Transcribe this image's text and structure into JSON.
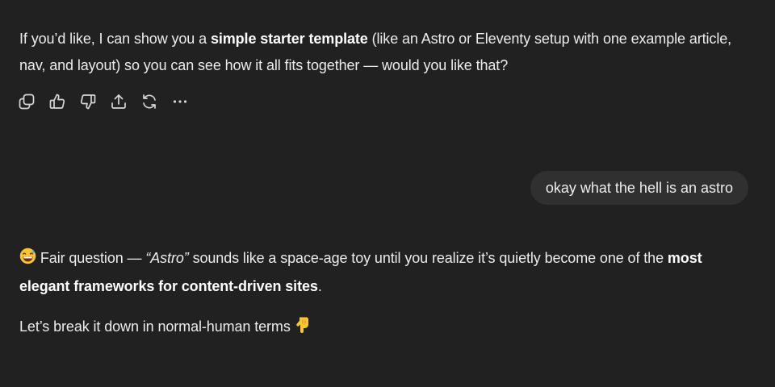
{
  "assistant_message_1": {
    "text_before": "If you’d like, I can show you a ",
    "bold": "simple starter template",
    "text_after": " (like an Astro or Eleventy setup with one example article, nav, and layout) so you can see how it all fits together — would you like that?"
  },
  "message_actions": [
    {
      "name": "copy-button",
      "icon": "copy-icon",
      "label": "Copy"
    },
    {
      "name": "good-response-button",
      "icon": "thumbs-up-icon",
      "label": "Good response"
    },
    {
      "name": "bad-response-button",
      "icon": "thumbs-down-icon",
      "label": "Bad response"
    },
    {
      "name": "share-button",
      "icon": "share-icon",
      "label": "Share"
    },
    {
      "name": "regenerate-button",
      "icon": "refresh-icon",
      "label": "Try again"
    },
    {
      "name": "more-actions-button",
      "icon": "more-horizontal-icon",
      "label": "More actions"
    }
  ],
  "user_message": {
    "text": "okay what the hell is an astro"
  },
  "assistant_message_2": {
    "emoji": "grinning-sweat-emoji",
    "text_1": " Fair question — ",
    "italic": "“Astro”",
    "text_2": " sounds like a space-age toy until you realize it’s quietly become one of the ",
    "bold": "most elegant frameworks for content-driven sites",
    "text_3": "."
  },
  "assistant_message_3": {
    "text": "Let’s break it down in normal-human terms ",
    "emoji": "backhand-index-pointing-down-emoji"
  },
  "colors": {
    "background": "#212121",
    "text": "#ececec",
    "user_bubble": "#303030",
    "emoji_yellow": "#fbc52d"
  }
}
